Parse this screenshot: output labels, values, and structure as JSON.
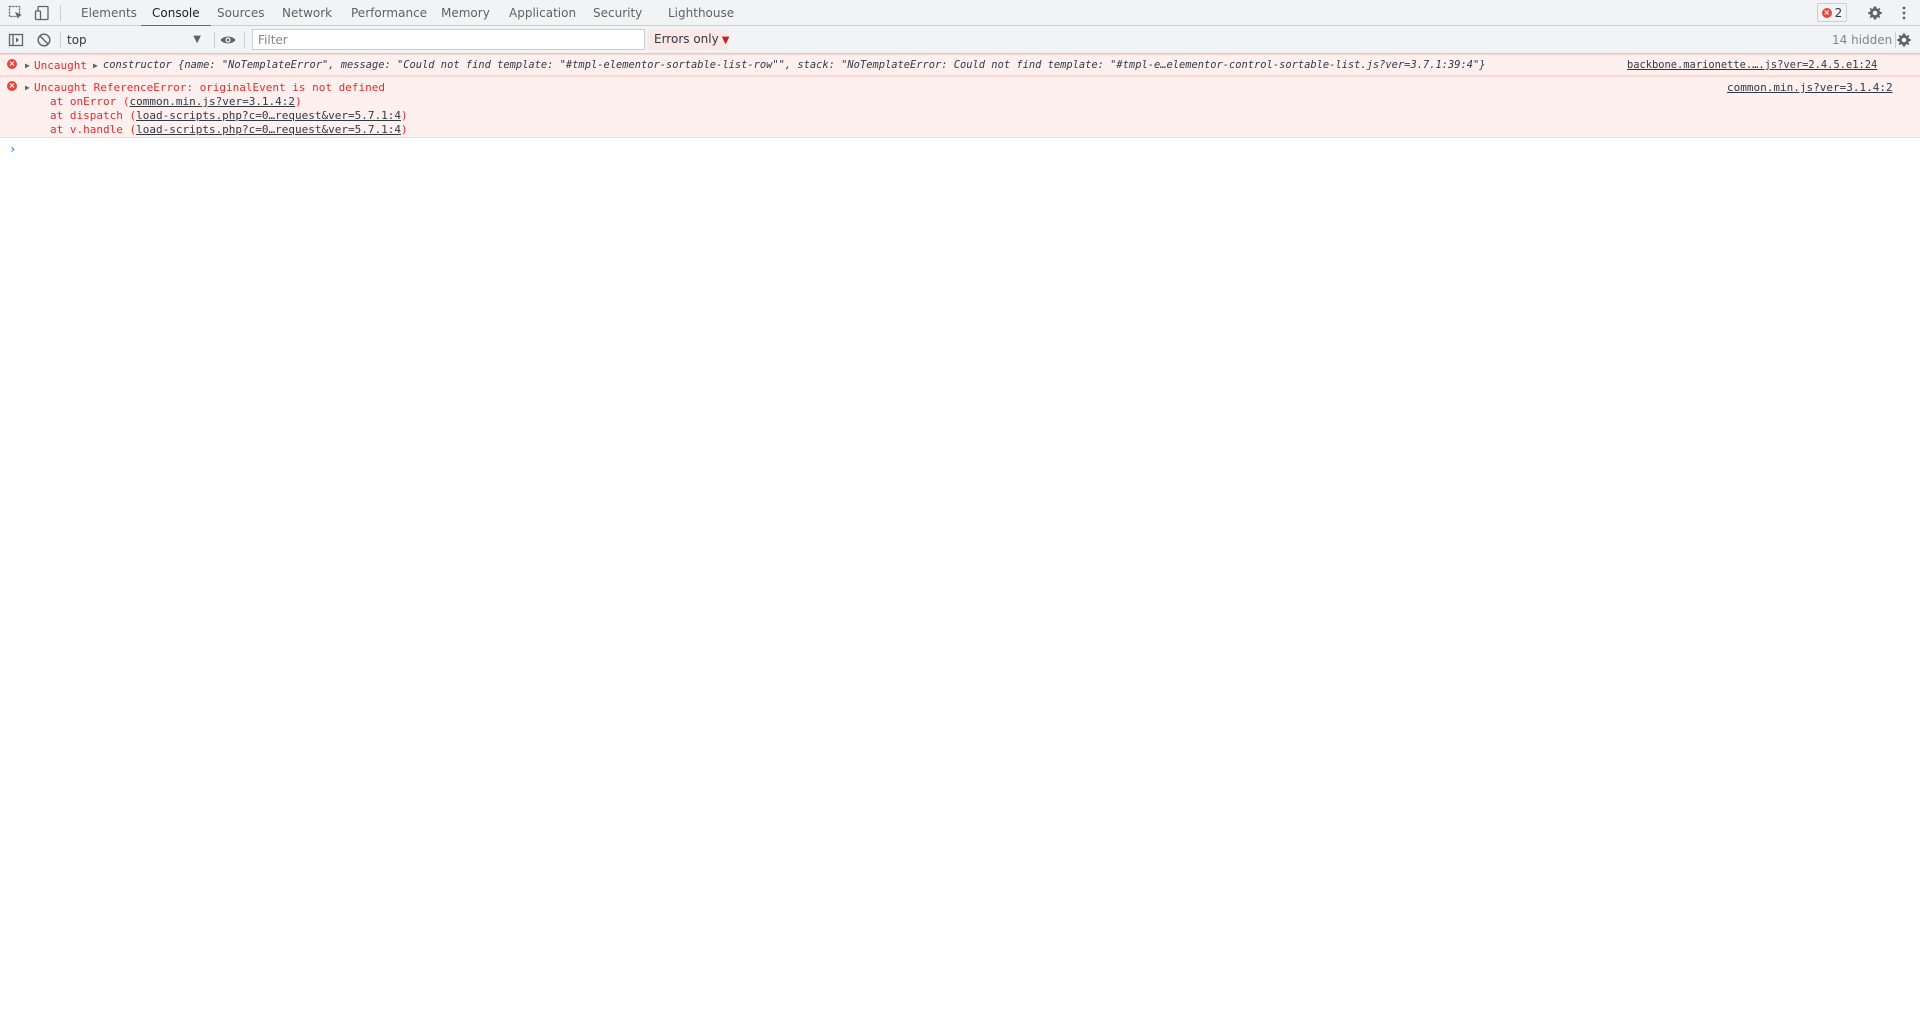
{
  "devtools": {
    "tabs": [
      {
        "label": "Elements"
      },
      {
        "label": "Console"
      },
      {
        "label": "Sources"
      },
      {
        "label": "Network"
      },
      {
        "label": "Performance"
      },
      {
        "label": "Memory"
      },
      {
        "label": "Application"
      },
      {
        "label": "Security"
      },
      {
        "label": "Lighthouse"
      }
    ],
    "active_tab": "Console",
    "error_count": "2",
    "icons": {
      "inspect": "inspect-element-icon",
      "device": "device-toolbar-icon",
      "settings": "gear-icon",
      "more": "kebab-menu-icon"
    },
    "accent_color": "#1a73e8",
    "error_color": "#e8453c"
  },
  "toolbar": {
    "context": "top",
    "filter_placeholder": "Filter",
    "levels": "Errors only",
    "hidden_count": "14 hidden"
  },
  "messages": [
    {
      "prefix": "Uncaught",
      "text": "constructor {name: \"NoTemplateError\", message: \"Could not find template: \"#tmpl-elementor-sortable-list-row\"\", stack: \"NoTemplateError: Could not find template: \"#tmpl-e…elementor-control-sortable-list.js?ver=3.7.1:39:4\"}",
      "source": "backbone.marionette.….js?ver=2.4.5.e1:24"
    },
    {
      "text": "Uncaught ReferenceError: originalEvent is not defined",
      "source": "common.min.js?ver=3.1.4:2",
      "stack": [
        {
          "prefix": "at onError (",
          "link": "common.min.js?ver=3.1.4:2",
          "suffix": ")"
        },
        {
          "prefix": "at dispatch (",
          "link": "load-scripts.php?c=0…request&ver=5.7.1:4",
          "suffix": ")"
        },
        {
          "prefix": "at v.handle (",
          "link": "load-scripts.php?c=0…request&ver=5.7.1:4",
          "suffix": ")"
        }
      ]
    }
  ],
  "prompt": "›"
}
